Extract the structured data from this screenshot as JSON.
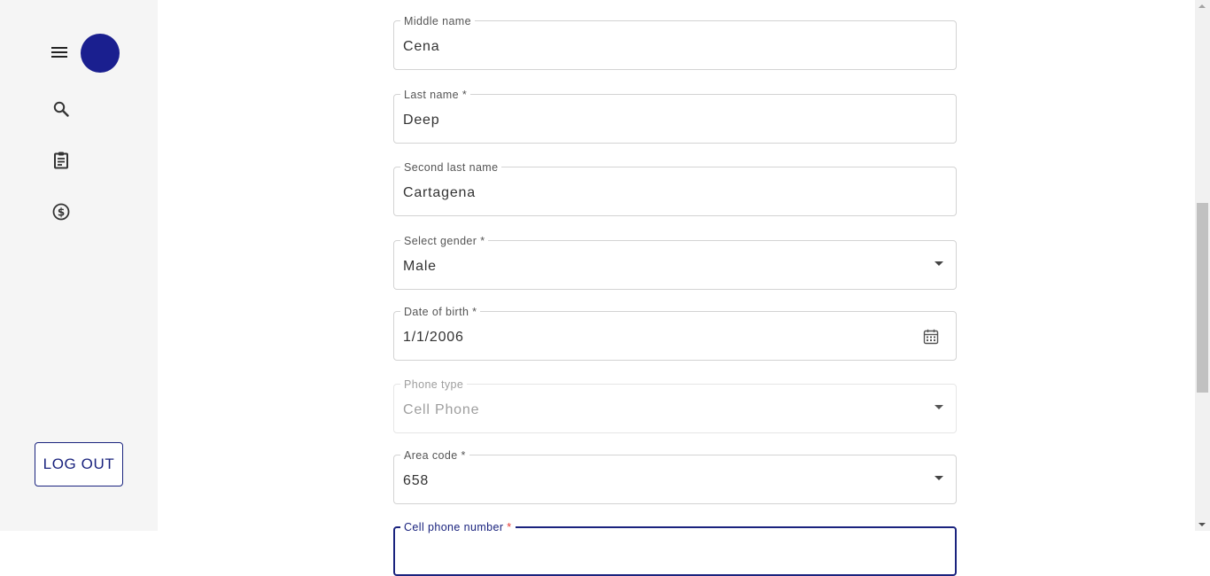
{
  "sidebar": {
    "menu_icon": "menu-icon",
    "nav_items": [
      {
        "icon": "search-icon"
      },
      {
        "icon": "clipboard-icon"
      },
      {
        "icon": "dollar-circle-icon"
      }
    ],
    "logout_label": "LOG OUT",
    "accent_color": "#1a1f8f"
  },
  "form": {
    "middle_name": {
      "label": "Middle name",
      "value": "Cena"
    },
    "last_name": {
      "label": "Last name *",
      "value": "Deep"
    },
    "second_last_name": {
      "label": "Second last name",
      "value": "Cartagena"
    },
    "gender": {
      "label": "Select gender *",
      "value": "Male"
    },
    "date_of_birth": {
      "label": "Date of birth *",
      "value": "1/1/2006"
    },
    "phone_type": {
      "label": "Phone type",
      "value": "Cell Phone"
    },
    "area_code": {
      "label": "Area code *",
      "value": "658"
    },
    "cell_phone": {
      "label": "Cell phone number",
      "required_mark": "*"
    }
  }
}
